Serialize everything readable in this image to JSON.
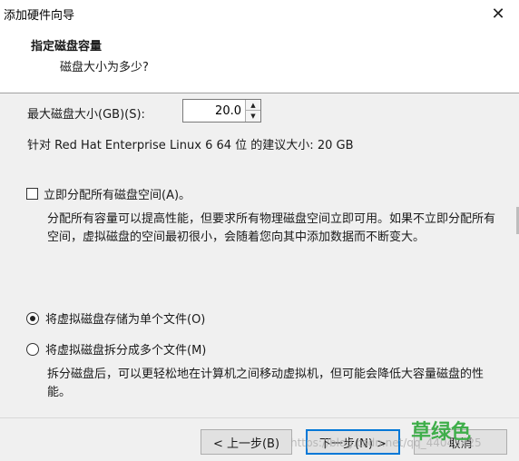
{
  "window": {
    "title": "添加硬件向导",
    "close_symbol": "✕"
  },
  "header": {
    "title": "指定磁盘容量",
    "subtitle": "磁盘大小为多少?"
  },
  "disk_size": {
    "label": "最大磁盘大小(GB)(S):",
    "value": "20.0"
  },
  "recommendation": "针对 Red Hat Enterprise Linux 6 64 位 的建议大小: 20 GB",
  "allocate_now": {
    "label": "立即分配所有磁盘空间(A)。",
    "checked": false,
    "description": "分配所有容量可以提高性能，但要求所有物理磁盘空间立即可用。如果不立即分配所有空间，虚拟磁盘的空间最初很小，会随着您向其中添加数据而不断变大。"
  },
  "storage_options": [
    {
      "label": "将虚拟磁盘存储为单个文件(O)",
      "selected": true
    },
    {
      "label": "将虚拟磁盘拆分成多个文件(M)",
      "selected": false
    }
  ],
  "split_description": "拆分磁盘后，可以更轻松地在计算机之间移动虚拟机，但可能会降低大容量磁盘的性能。",
  "buttons": {
    "back": "< 上一步(B)",
    "next": "下一步(N) >",
    "cancel": "取消"
  },
  "watermark": {
    "brand": "草绿色",
    "url": "https://blog.csdn.net/qq_44045825",
    "brand_color": "#3fae4a"
  },
  "colors": {
    "accent": "#0078d7"
  }
}
